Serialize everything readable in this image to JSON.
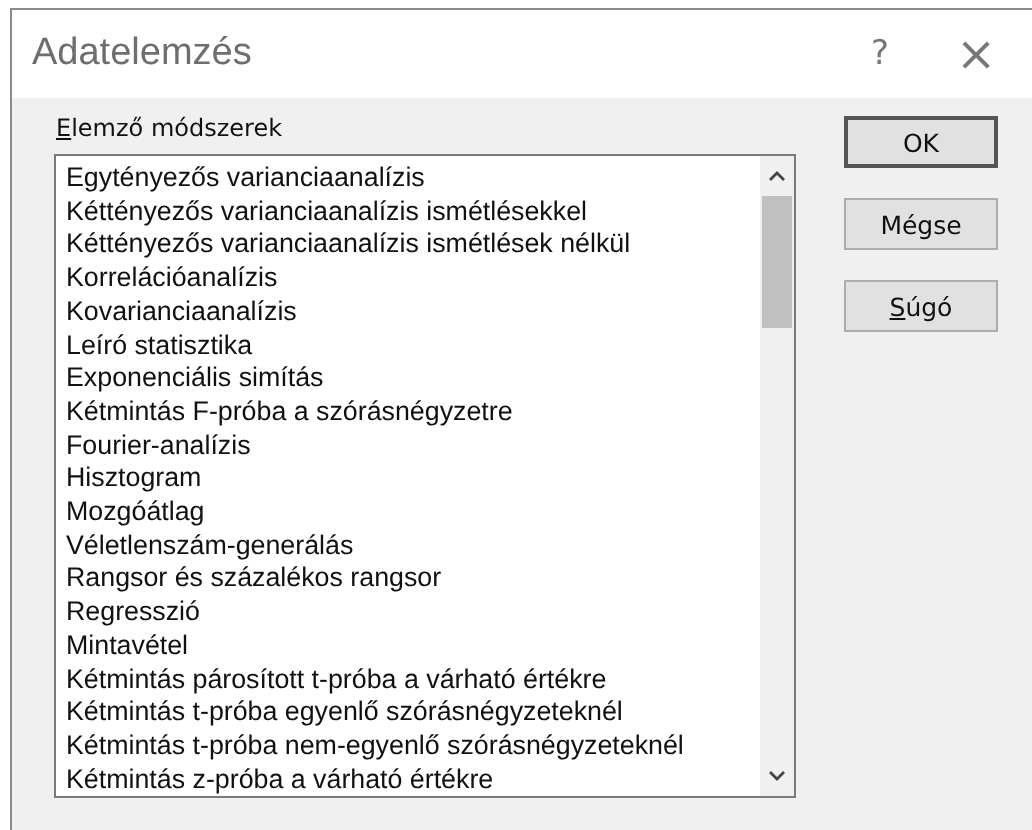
{
  "window": {
    "title": "Adatelemzés",
    "help": "?",
    "close": "×"
  },
  "methods_label": {
    "mnemonic": "E",
    "rest": "lemző módszerek"
  },
  "methods": [
    {
      "label": "Egytényezős varianciaanalízis",
      "selected": false
    },
    {
      "label": "Kéttényezős varianciaanalízis ismétlésekkel",
      "selected": false
    },
    {
      "label": "Kéttényezős varianciaanalízis ismétlések nélkül",
      "selected": false
    },
    {
      "label": "Korrelációanalízis",
      "selected": false
    },
    {
      "label": "Kovarianciaanalízis",
      "selected": false
    },
    {
      "label": "Leíró statisztika",
      "selected": false
    },
    {
      "label": "Exponenciális simítás",
      "selected": false
    },
    {
      "label": "Kétmintás F-próba a szórásnégyzetre",
      "selected": false
    },
    {
      "label": "Fourier-analízis",
      "selected": false
    },
    {
      "label": "Hisztogram",
      "selected": false
    },
    {
      "label": "Mozgóátlag",
      "selected": false
    },
    {
      "label": "Véletlenszám-generálás",
      "selected": false
    },
    {
      "label": "Rangsor és százalékos rangsor",
      "selected": false
    },
    {
      "label": "Regresszió",
      "selected": false
    },
    {
      "label": "Mintavétel",
      "selected": false
    },
    {
      "label": "Kétmintás párosított t-próba a várható értékre",
      "selected": false
    },
    {
      "label": "Kétmintás t-próba egyenlő szórásnégyzeteknél",
      "selected": false
    },
    {
      "label": "Kétmintás t-próba nem-egyenlő szórásnégyzeteknél",
      "selected": false
    },
    {
      "label": "Kétmintás z-próba a várható értékre",
      "selected": false
    }
  ],
  "buttons": [
    {
      "rest": "OK",
      "default": true
    },
    {
      "rest": "Mégse",
      "default": false
    },
    {
      "mnemonic": "S",
      "rest": "úgó",
      "default": false
    }
  ]
}
